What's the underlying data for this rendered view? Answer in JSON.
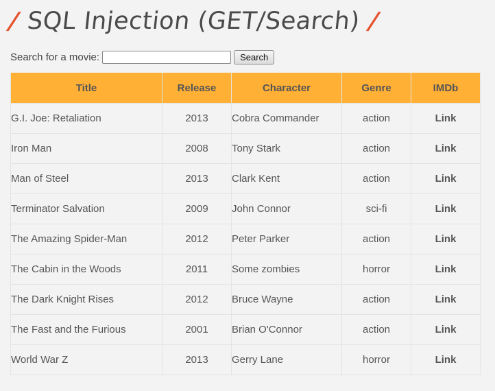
{
  "header": {
    "slash_left": "/",
    "title": "SQL Injection (GET/Search)",
    "slash_right": "/"
  },
  "search": {
    "label": "Search for a movie:",
    "value": "",
    "placeholder": "",
    "button_label": "Search"
  },
  "table": {
    "headers": [
      "Title",
      "Release",
      "Character",
      "Genre",
      "IMDb"
    ],
    "rows": [
      {
        "title": "G.I. Joe: Retaliation",
        "release": "2013",
        "character": "Cobra Commander",
        "genre": "action",
        "imdb": "Link"
      },
      {
        "title": "Iron Man",
        "release": "2008",
        "character": "Tony Stark",
        "genre": "action",
        "imdb": "Link"
      },
      {
        "title": "Man of Steel",
        "release": "2013",
        "character": "Clark Kent",
        "genre": "action",
        "imdb": "Link"
      },
      {
        "title": "Terminator Salvation",
        "release": "2009",
        "character": "John Connor",
        "genre": "sci-fi",
        "imdb": "Link"
      },
      {
        "title": "The Amazing Spider-Man",
        "release": "2012",
        "character": "Peter Parker",
        "genre": "action",
        "imdb": "Link"
      },
      {
        "title": "The Cabin in the Woods",
        "release": "2011",
        "character": "Some zombies",
        "genre": "horror",
        "imdb": "Link"
      },
      {
        "title": "The Dark Knight Rises",
        "release": "2012",
        "character": "Bruce Wayne",
        "genre": "action",
        "imdb": "Link"
      },
      {
        "title": "The Fast and the Furious",
        "release": "2001",
        "character": "Brian O'Connor",
        "genre": "action",
        "imdb": "Link"
      },
      {
        "title": "World War Z",
        "release": "2013",
        "character": "Gerry Lane",
        "genre": "horror",
        "imdb": "Link"
      }
    ]
  },
  "colors": {
    "accent": "#e5532d",
    "header_bg": "#ffb035",
    "page_bg": "#f3f3f3"
  }
}
